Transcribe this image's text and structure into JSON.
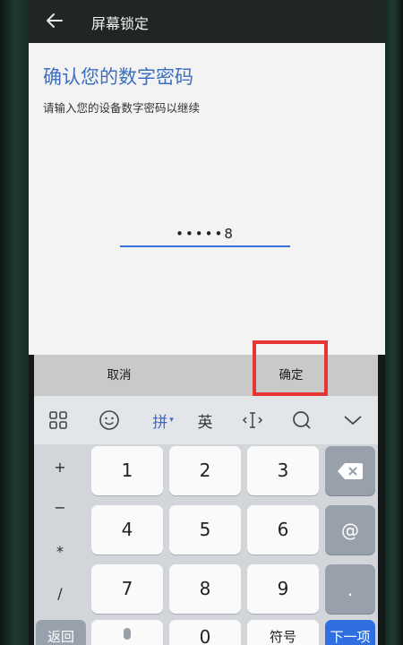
{
  "header": {
    "title": "屏幕锁定"
  },
  "main": {
    "title": "确认您的数字密码",
    "subtitle": "请输入您的设备数字密码以继续",
    "pin_display": "•••••8"
  },
  "actions": {
    "cancel": "取消",
    "confirm": "确定"
  },
  "keyboard": {
    "toolbar": {
      "pinyin": "拼",
      "english": "英",
      "icons": [
        "grid-icon",
        "emoji-icon",
        "cursor-move-icon",
        "search-icon",
        "collapse-icon"
      ]
    },
    "symbols": [
      "+",
      "−",
      "*",
      "/"
    ],
    "digits": [
      "1",
      "2",
      "3",
      "4",
      "5",
      "6",
      "7",
      "8",
      "9",
      "0"
    ],
    "right_keys": {
      "at": "@",
      "dot": "."
    },
    "bottom": {
      "back": "返回",
      "fullwidth": "符号",
      "next": "下一项"
    }
  },
  "colors": {
    "accent": "#3c6fbf",
    "highlight": "#e53535",
    "enter": "#2f6fe0"
  }
}
